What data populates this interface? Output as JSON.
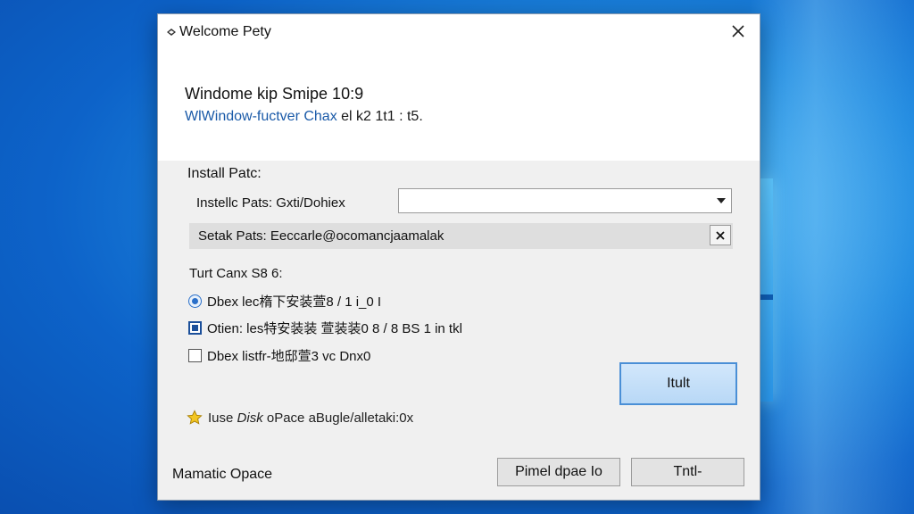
{
  "window": {
    "title": "Welcome Pety",
    "close_label": "✕"
  },
  "header": {
    "heading": "Windome kip Smipe 10:9",
    "link_text": "WlWindow-fuctver Chax",
    "link_rest": " el k2 1t1 : t5."
  },
  "install": {
    "section_label": "Install Patc:",
    "path_label": "Instellc Pats: Gxti/Dohiex",
    "dropdown_value": "",
    "current_path": "Setak Pats: Eeccarle@ocomancjaamalak",
    "clear_label": "✕"
  },
  "options": {
    "section_label": "Turt Canx S8 6:",
    "items": [
      {
        "label": "Dbex lec楕下安装萱8 / 1 i_0 I"
      },
      {
        "label": "Otien: les特安装装 萱装装0 8 / 8 BS  1 in tkl"
      },
      {
        "label": "Dbex listfr-地邸萱3 vc Dnx0"
      }
    ]
  },
  "primary_button": "Itult",
  "disk": {
    "prefix": "Iuse ",
    "emph": "Disk",
    "suffix": " oPace aBugle/alletaki:0x"
  },
  "footer": {
    "label": "Mamatic Opace",
    "button_1": "Pimel dpae Io",
    "button_2": "Tntl-"
  },
  "colors": {
    "accent": "#2a6fc9",
    "link": "#1a5aa8",
    "primary_bg": "#b8d8f6"
  }
}
